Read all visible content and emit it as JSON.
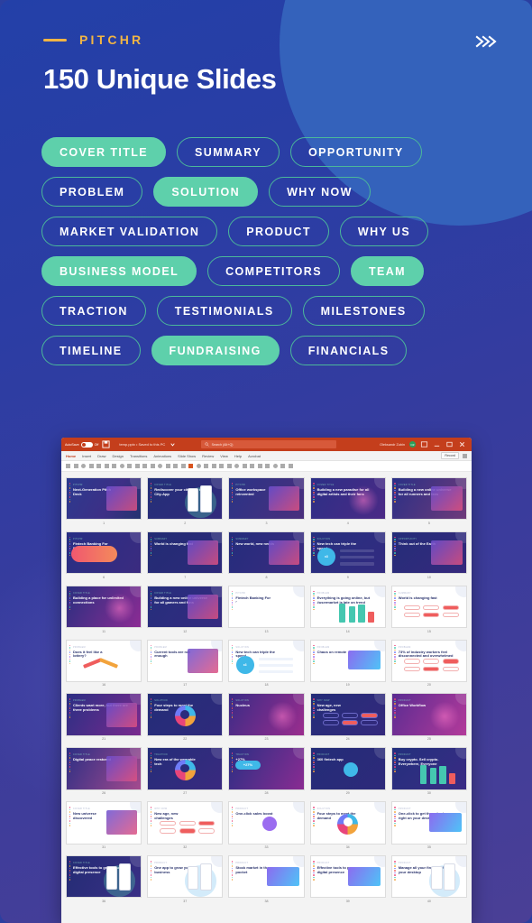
{
  "header": {
    "brand": "PITCHR",
    "title": "150 Unique Slides",
    "chevron_icon": "double-chevron-right-icon",
    "accent_brand_color": "#f2b544",
    "accent_pill_color": "#5ed0ab",
    "bg_color": "#2b3da4"
  },
  "pills": [
    {
      "label": "COVER TITLE",
      "active": true
    },
    {
      "label": "SUMMARY",
      "active": false
    },
    {
      "label": "OPPORTUNITY",
      "active": false
    },
    {
      "label": "PROBLEM",
      "active": false
    },
    {
      "label": "SOLUTION",
      "active": true
    },
    {
      "label": "WHY NOW",
      "active": false
    },
    {
      "label": "MARKET VALIDATION",
      "active": false
    },
    {
      "label": "PRODUCT",
      "active": false
    },
    {
      "label": "WHY US",
      "active": false
    },
    {
      "label": "BUSINESS MODEL",
      "active": true
    },
    {
      "label": "COMPETITORS",
      "active": false
    },
    {
      "label": "TEAM",
      "active": true
    },
    {
      "label": "TRACTION",
      "active": false
    },
    {
      "label": "TESTIMONIALS",
      "active": false
    },
    {
      "label": "MILESTONES",
      "active": false
    },
    {
      "label": "TIMELINE",
      "active": false
    },
    {
      "label": "FUNDRAISING",
      "active": true
    },
    {
      "label": "FINANCIALS",
      "active": false
    }
  ],
  "powerpoint": {
    "titlebar": {
      "autosave_label": "AutoSave",
      "autosave_state": "Off",
      "save_icon": "save-icon",
      "document_name": "temp.pptx • Saved to this PC",
      "dropdown_icon": "chevron-down-icon",
      "search_icon": "search-icon",
      "search_placeholder": "Search (Alt+Q)",
      "user_name": "Oleksandr Zubin",
      "avatar_initials": "OZ",
      "ribbon_display_icon": "ribbon-display-icon",
      "minimize_icon": "minimize-icon",
      "restore_icon": "restore-icon",
      "close_icon": "close-icon"
    },
    "ribbon_tabs": [
      {
        "label": "Home",
        "active": true
      },
      {
        "label": "Insert",
        "active": false
      },
      {
        "label": "Draw",
        "active": false
      },
      {
        "label": "Design",
        "active": false
      },
      {
        "label": "Transitions",
        "active": false
      },
      {
        "label": "Animations",
        "active": false
      },
      {
        "label": "Slide Show",
        "active": false
      },
      {
        "label": "Review",
        "active": false
      },
      {
        "label": "View",
        "active": false
      },
      {
        "label": "Help",
        "active": false
      },
      {
        "label": "Acrobat",
        "active": false
      }
    ],
    "ribbon_right": {
      "record_label": "Record",
      "record_icon": "record-icon",
      "share_icon": "share-icon"
    },
    "view": "slide-sorter",
    "slides": [
      {
        "n": "1",
        "kicker": "PITCHR",
        "title": "Next-Generation Pitch Deck",
        "theme": "dark-photo"
      },
      {
        "n": "2",
        "kicker": "COVER TITLE",
        "title": "Rediscover your city with the City-App",
        "theme": "dark-phone"
      },
      {
        "n": "3",
        "kicker": "PITCHR",
        "title": "Office workspace reinvented",
        "theme": "dark-photo2"
      },
      {
        "n": "4",
        "kicker": "COVER TITLE",
        "title": "Building a new paradise for all digital artists and their fans",
        "theme": "dark-neon"
      },
      {
        "n": "5",
        "kicker": "COVER TITLE",
        "title": "Building a new online universe for all runners and fans",
        "theme": "dark-warm"
      },
      {
        "n": "6",
        "kicker": "PITCHR",
        "title": "Fintech Banking For Everyone",
        "theme": "dark-blob"
      },
      {
        "n": "7",
        "kicker": "SUMMARY",
        "title": "World is changing fast",
        "theme": "dark-cards"
      },
      {
        "n": "8",
        "kicker": "SUMMARY",
        "title": "New world, new needs",
        "theme": "dark-photo3"
      },
      {
        "n": "9",
        "kicker": "SOLUTION",
        "title": "New tech can triple the speed",
        "theme": "dark-x3"
      },
      {
        "n": "10",
        "kicker": "OPPORTUNITY",
        "title": "Think out of the Earth",
        "theme": "dark-list"
      },
      {
        "n": "11",
        "kicker": "COVER TITLE",
        "title": "Building a place for unlimited connections",
        "theme": "dark-magenta"
      },
      {
        "n": "12",
        "kicker": "COVER TITLE",
        "title": "Building a new online universe for all gamers and fans",
        "theme": "dark-wires"
      },
      {
        "n": "13",
        "kicker": "PITCHR",
        "title": "Fintech Banking For Everyone",
        "theme": "light-fintech"
      },
      {
        "n": "14",
        "kicker": "PROBLEM",
        "title": "Everything is going online, but #usermarket is late on trend",
        "theme": "light-bars"
      },
      {
        "n": "15",
        "kicker": "SUMMARY",
        "title": "World is changing fast",
        "theme": "light-pills"
      },
      {
        "n": "16",
        "kicker": "PROBLEM",
        "title": "Does it feel like a lottery?",
        "theme": "light-arrows"
      },
      {
        "n": "17",
        "kicker": "PROBLEM",
        "title": "Current tools are not enough",
        "theme": "light-portrait"
      },
      {
        "n": "18",
        "kicker": "SOLUTION",
        "title": "New tech can triple the speed",
        "theme": "light-x3"
      },
      {
        "n": "19",
        "kicker": "PROBLEM",
        "title": "Chaos on remote",
        "theme": "light-laptop"
      },
      {
        "n": "20",
        "kicker": "PROBLEM",
        "title": "73% of industry workers feel disconnected and overwhelmed",
        "theme": "light-redcards"
      },
      {
        "n": "21",
        "kicker": "PROBLEM",
        "title": "Clients want more, but there are three problems",
        "theme": "dark-pinkcards"
      },
      {
        "n": "22",
        "kicker": "SOLUTION",
        "title": "Four steps to meet the demand",
        "theme": "dark-donut"
      },
      {
        "n": "23",
        "kicker": "SOLUTION",
        "title": "Nucleus",
        "theme": "dark-orbit"
      },
      {
        "n": "24",
        "kicker": "WHY NOW",
        "title": "New age, new challenges",
        "theme": "dark-tags"
      },
      {
        "n": "25",
        "kicker": "PRODUCT",
        "title": "Office Workflow",
        "theme": "dark-icons"
      },
      {
        "n": "26",
        "kicker": "COVER TITLE",
        "title": "Digital peace restored",
        "theme": "dark-scene"
      },
      {
        "n": "27",
        "kicker": "TRACTION",
        "title": "New era of the wearable tech",
        "theme": "dark-ring"
      },
      {
        "n": "28",
        "kicker": "TRACTION",
        "title": "+27%",
        "theme": "dark-growth"
      },
      {
        "n": "29",
        "kicker": "PRODUCT",
        "title": "360 fintech app",
        "theme": "dark-flow"
      },
      {
        "n": "30",
        "kicker": "PRODUCT",
        "title": "Buy crypto. Sell crypto. Everywhere, Everyone",
        "theme": "dark-chart"
      },
      {
        "n": "31",
        "kicker": "COVER TITLE",
        "title": "New universe discovered",
        "theme": "light-crowd"
      },
      {
        "n": "32",
        "kicker": "WHY NOW",
        "title": "New age, new challenges",
        "theme": "light-tags"
      },
      {
        "n": "33",
        "kicker": "PRODUCT",
        "title": "One-click sales boost",
        "theme": "light-cloud"
      },
      {
        "n": "34",
        "kicker": "SOLUTION",
        "title": "Four steps to meet the demand",
        "theme": "light-donut"
      },
      {
        "n": "35",
        "kicker": "PRODUCT",
        "title": "One-click to get the sales team right on your desktop",
        "theme": "light-hand"
      },
      {
        "n": "36",
        "kicker": "COVER TITLE",
        "title": "Effective tools to grow your digital presence",
        "theme": "dark-mobile"
      },
      {
        "n": "37",
        "kicker": "PRODUCT",
        "title": "One app to grow your business",
        "theme": "light-app"
      },
      {
        "n": "38",
        "kicker": "PRODUCT",
        "title": "Stock market in the pocket",
        "theme": "light-stock"
      },
      {
        "n": "39",
        "kicker": "PRODUCT",
        "title": "Effective tools to grow your digital presence",
        "theme": "light-imac"
      },
      {
        "n": "40",
        "kicker": "PRODUCT",
        "title": "Manage all your finances from your desktop",
        "theme": "light-finance"
      }
    ]
  }
}
